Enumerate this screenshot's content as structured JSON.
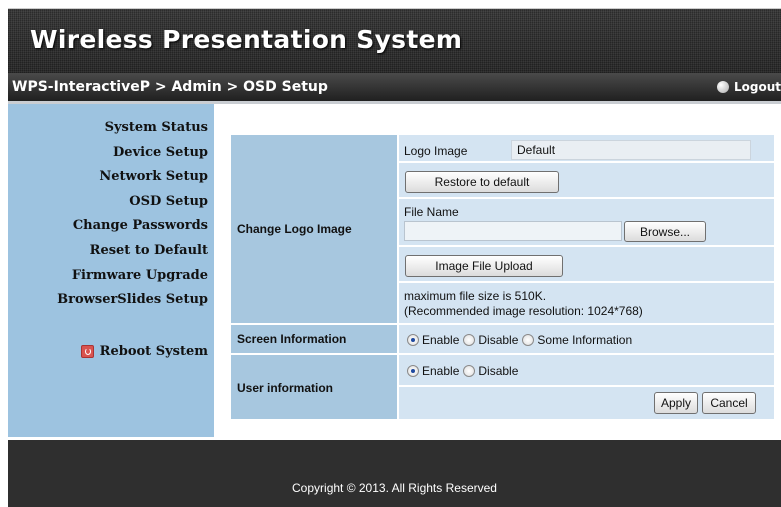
{
  "header": {
    "title": "Wireless Presentation System"
  },
  "breadcrumb": "WPS-InteractiveP > Admin > OSD Setup",
  "logout_label": "Logout",
  "sidebar": {
    "items": [
      {
        "label": "System Status"
      },
      {
        "label": "Device Setup"
      },
      {
        "label": "Network Setup"
      },
      {
        "label": "OSD Setup"
      },
      {
        "label": "Change Passwords"
      },
      {
        "label": "Reset to Default"
      },
      {
        "label": "Firmware Upgrade"
      },
      {
        "label": "BrowserSlides Setup"
      }
    ],
    "reboot_label": "Reboot System"
  },
  "logo_section": {
    "section_label": "Change Logo Image",
    "logo_image_label": "Logo Image",
    "logo_image_value": "Default",
    "restore_button": "Restore to default",
    "file_name_label": "File Name",
    "file_name_value": "",
    "browse_button": "Browse...",
    "upload_button": "Image File Upload",
    "note_line1": "maximum file size is 510K.",
    "note_line2": "(Recommended image resolution: 1024*768)"
  },
  "screen_info": {
    "label": "Screen Information",
    "options": [
      "Enable",
      "Disable",
      "Some Information"
    ],
    "selected": "Enable"
  },
  "user_info": {
    "label": "User information",
    "options": [
      "Enable",
      "Disable"
    ],
    "selected": "Enable"
  },
  "actions": {
    "apply": "Apply",
    "cancel": "Cancel"
  },
  "footer": {
    "copyright": "Copyright © 2013. All Rights Reserved"
  }
}
